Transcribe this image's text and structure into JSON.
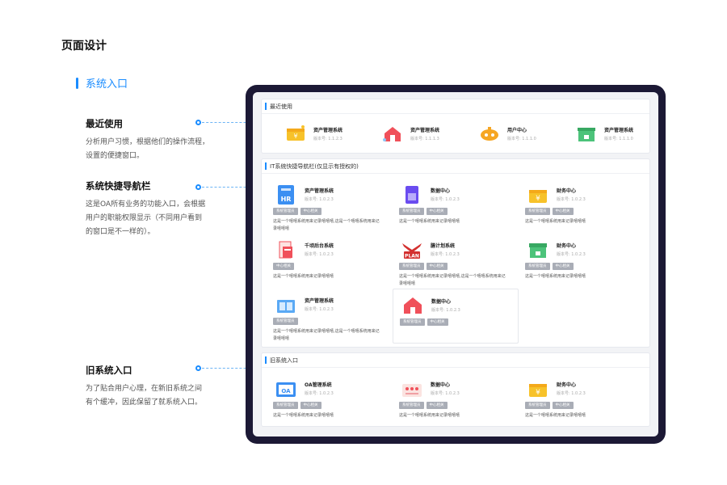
{
  "page_title": "页面设计",
  "section_title": "系统入口",
  "annotations": [
    {
      "title": "最近使用",
      "lines": [
        "分析用户习惯，根据他们的操作流程，",
        "设置的便捷窗口。"
      ]
    },
    {
      "title": "系统快捷导航栏",
      "lines": [
        "这是OA所有业务的功能入口，会根据",
        "用户的职能权限显示（不同用户看到",
        "的窗口是不一样的）。"
      ]
    },
    {
      "title": "旧系统入口",
      "lines": [
        "为了贴合用户心理，在新旧系统之间",
        "有个缓冲，因此保留了就系统入口。"
      ]
    }
  ],
  "recent": {
    "title": "最近使用",
    "items": [
      {
        "name": "资产管理系统",
        "version": "版本号: 1.1.2.3",
        "icon": "yen-box-icon"
      },
      {
        "name": "资产管理系统",
        "version": "版本号: 1.1.1.3",
        "icon": "red-house-icon"
      },
      {
        "name": "用户中心",
        "version": "版本号: 1.1.1.0",
        "icon": "robot-icon"
      },
      {
        "name": "资产管理系统",
        "version": "版本号: 1.1.1.0",
        "icon": "bank-icon"
      }
    ]
  },
  "nav": {
    "title": "IT系统快捷导航栏(仅显示有授权的)",
    "cards": [
      {
        "name": "资产管理系统",
        "version": "版本号: 1.0.2.3",
        "tags": [
          "系统管理员",
          "中心相关"
        ],
        "desc": "这是一个嘻嘻系统用来记录嘻嘻嘻,这是一个嘻嘻系统用来记录嘻嘻嘻",
        "icon": "hr-icon"
      },
      {
        "name": "数据中心",
        "version": "版本号: 1.0.2.3",
        "tags": [
          "系统管理员",
          "中心相关"
        ],
        "desc": "这是一个嘻嘻系统用来记录嘻嘻嘻",
        "icon": "data-center-icon"
      },
      {
        "name": "财务中心",
        "version": "版本号: 1.0.2.3",
        "tags": [
          "系统管理员",
          "中心相关"
        ],
        "desc": "这是一个嘻嘻系统用来记录嘻嘻嘻",
        "icon": "yen-box-icon"
      },
      {
        "name": "千顷后台系统",
        "version": "版本号: 1.0.2.3",
        "tags": [
          "中心相关"
        ],
        "desc": "这是一个嘻嘻系统用来记录嘻嘻嘻",
        "icon": "forms-icon"
      },
      {
        "name": "膳计划系统",
        "version": "版本号: 1.0.2.3",
        "tags": [
          "系统管理员",
          "中心相关"
        ],
        "desc": "这是一个嘻嘻系统用来记录嘻嘻嘻,这是一个嘻嘻系统用来记录嘻嘻嘻",
        "icon": "plan-icon"
      },
      {
        "name": "财务中心",
        "version": "版本号: 1.0.2.3",
        "tags": [
          "系统管理员",
          "中心相关"
        ],
        "desc": "这是一个嘻嘻系统用来记录嘻嘻嘻",
        "icon": "bank-icon"
      },
      {
        "name": "资产管理系统",
        "version": "版本号: 1.0.2.3",
        "tags": [
          "系统管理员"
        ],
        "desc": "这是一个嘻嘻系统用来记录嘻嘻嘻,这是一个嘻嘻系统用来记录嘻嘻嘻",
        "icon": "book-icon"
      },
      {
        "name": "数据中心",
        "version": "版本号: 1.0.2.3",
        "tags": [
          "系统管理员",
          "中心相关"
        ],
        "desc": "",
        "icon": "red-house-icon"
      }
    ]
  },
  "old": {
    "title": "旧系统入口",
    "cards": [
      {
        "name": "OA管理系统",
        "version": "版本号: 1.0.2.3",
        "tags": [
          "系统管理员",
          "中心相关"
        ],
        "desc": "这是一个嘻嘻系统用来记录嘻嘻嘻",
        "icon": "oa-icon"
      },
      {
        "name": "数据中心",
        "version": "版本号: 1.0.2.3",
        "tags": [
          "系统管理员",
          "中心相关"
        ],
        "desc": "这是一个嘻嘻系统用来记录嘻嘻嘻",
        "icon": "dashboard-icon"
      },
      {
        "name": "财务中心",
        "version": "版本号: 1.0.2.3",
        "tags": [
          "系统管理员",
          "中心相关"
        ],
        "desc": "这是一个嘻嘻系统用来记录嘻嘻嘻",
        "icon": "yen-box-icon"
      }
    ]
  },
  "colors": {
    "accent": "#1a8cff",
    "tablet": "#1c1935",
    "tag": "#a9adb6"
  }
}
